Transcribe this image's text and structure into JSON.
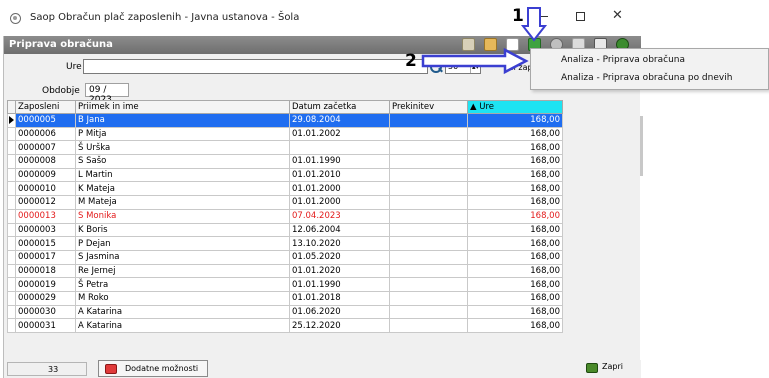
{
  "window": {
    "title": "Saop Obračun plač zaposlenih - Javna ustanova - Šola",
    "minimize_label": "–",
    "maximize_label": "",
    "close_label": "✕"
  },
  "panel": {
    "title": "Priprava obračuna"
  },
  "filter": {
    "ure_label": "Ure",
    "ure_value": "",
    "count_value": "50",
    "vsi_label": "Vsi zap"
  },
  "period": {
    "label": "Obdobje",
    "value": "09 / 2023"
  },
  "table": {
    "columns": [
      "Zaposleni",
      "Priimek in ime",
      "Datum začetka",
      "Prekinitev",
      "▲ Ure"
    ],
    "rows": [
      [
        "0000005",
        "B Jana",
        "29.08.2004",
        "",
        "168,00"
      ],
      [
        "0000006",
        "P Mitja",
        "01.01.2002",
        "",
        "168,00"
      ],
      [
        "0000007",
        "Š Urška",
        "",
        "",
        "168,00"
      ],
      [
        "0000008",
        "S Sašo",
        "01.01.1990",
        "",
        "168,00"
      ],
      [
        "0000009",
        "L Martin",
        "01.01.2010",
        "",
        "168,00"
      ],
      [
        "0000010",
        "K Mateja",
        "01.01.2000",
        "",
        "168,00"
      ],
      [
        "0000012",
        "M Mateja",
        "01.01.2000",
        "",
        "168,00"
      ],
      [
        "0000013",
        "S Monika",
        "07.04.2023",
        "",
        "168,00"
      ],
      [
        "0000003",
        "K Boris",
        "12.06.2004",
        "",
        "168,00"
      ],
      [
        "0000015",
        "P Dejan",
        "13.10.2020",
        "",
        "168,00"
      ],
      [
        "0000017",
        "S Jasmina",
        "01.05.2020",
        "",
        "168,00"
      ],
      [
        "0000018",
        "Re Jernej",
        "01.01.2020",
        "",
        "168,00"
      ],
      [
        "0000019",
        "Š Petra",
        "01.01.1990",
        "",
        "168,00"
      ],
      [
        "0000029",
        "M Roko",
        "01.01.2018",
        "",
        "168,00"
      ],
      [
        "0000030",
        "A Katarina",
        "01.06.2020",
        "",
        "168,00"
      ],
      [
        "0000031",
        "A Katarina",
        "25.12.2020",
        "",
        "168,00"
      ]
    ]
  },
  "dropdown": {
    "items": [
      "Analiza - Priprava obračuna",
      "Analiza - Priprava obračuna po dnevih"
    ]
  },
  "status": {
    "count": "33",
    "more_label": "Dodatne možnosti",
    "close_label": "Zapri"
  },
  "annotations": {
    "step1": "1",
    "step2": "2"
  },
  "colors": {
    "selected_row": "#1f6df0",
    "sorted_header": "#1ee3f2",
    "new_employee_text": "#e31b1b",
    "arrow": "#3b3fd1"
  }
}
